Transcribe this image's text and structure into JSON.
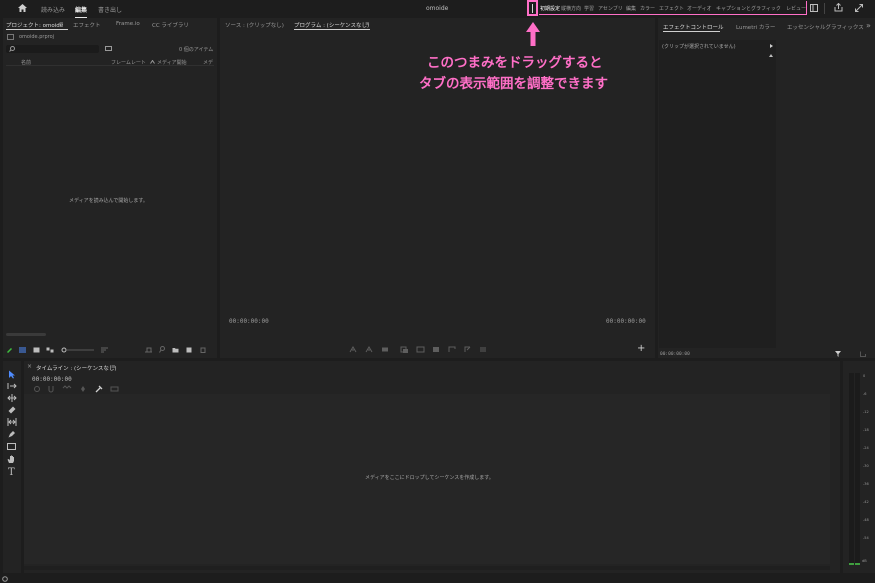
{
  "app": {
    "document_title": "omoide"
  },
  "topbar": {
    "mode_tabs": [
      {
        "label": "読み込み",
        "active": false
      },
      {
        "label": "編集",
        "active": true
      },
      {
        "label": "書き出し",
        "active": false
      }
    ],
    "workspaces": [
      {
        "label": "初期設定",
        "active": true
      },
      {
        "label": "縦横方向",
        "active": false
      },
      {
        "label": "学習",
        "active": false
      },
      {
        "label": "アセンブリ",
        "active": false
      },
      {
        "label": "編集",
        "active": false
      },
      {
        "label": "カラー",
        "active": false
      },
      {
        "label": "エフェクト",
        "active": false
      },
      {
        "label": "オーディオ",
        "active": false
      },
      {
        "label": "キャプションとグラフィック",
        "active": false
      },
      {
        "label": "レビュー",
        "active": false
      }
    ]
  },
  "annotation": {
    "line1": "このつまみをドラッグすると",
    "line2": "タブの表示範囲を調整できます",
    "color": "#ff6fc7"
  },
  "project_panel": {
    "tabs": [
      {
        "label": "プロジェクト: omoide",
        "active": true
      },
      {
        "label": "エフェクト",
        "active": false
      },
      {
        "label": "Frame.io",
        "active": false
      },
      {
        "label": "CC ライブラリ",
        "active": false
      }
    ],
    "menu_glyph": "≡",
    "file_name": "omoide.prproj",
    "item_count": "0 個のアイテム",
    "columns": [
      "名前",
      "フレームレート",
      "メディア開始",
      "メデ"
    ],
    "empty_message": "メディアを読み込んで開始します。"
  },
  "source_panel": {
    "tabs": [
      {
        "label": "ソース : (クリップなし)",
        "active": false
      },
      {
        "label": "プログラム : (シーケンスなし)",
        "active": true
      }
    ],
    "timecode_left": "00:00:00:00",
    "timecode_right": "00:00:00:00",
    "add_glyph": "+"
  },
  "effect_controls": {
    "tabs": [
      {
        "label": "エフェクトコントロール",
        "active": true
      },
      {
        "label": "Lumetri カラー",
        "active": false
      },
      {
        "label": "エッセンシャルグラフィックス",
        "active": false
      }
    ],
    "overflow_glyph": "»",
    "no_clip": "(クリップが選択されていません)",
    "timecode": "00:00:00:00"
  },
  "timeline": {
    "title": "タイムライン : (シーケンスなし)",
    "timecode": "00:00:00:00",
    "drop_message": "メディアをここにドロップしてシーケンスを作成します。",
    "close_glyph": "×"
  },
  "tools": [
    "selection-tool-icon",
    "track-select-icon",
    "ripple-edit-icon",
    "razor-icon",
    "slip-icon",
    "pen-icon",
    "rectangle-icon",
    "hand-icon",
    "type-icon"
  ],
  "audio_meter": {
    "labels": [
      "0",
      "-6",
      "-12",
      "-18",
      "-24",
      "-30",
      "-36",
      "-42",
      "-48",
      "-54",
      "dB"
    ]
  }
}
